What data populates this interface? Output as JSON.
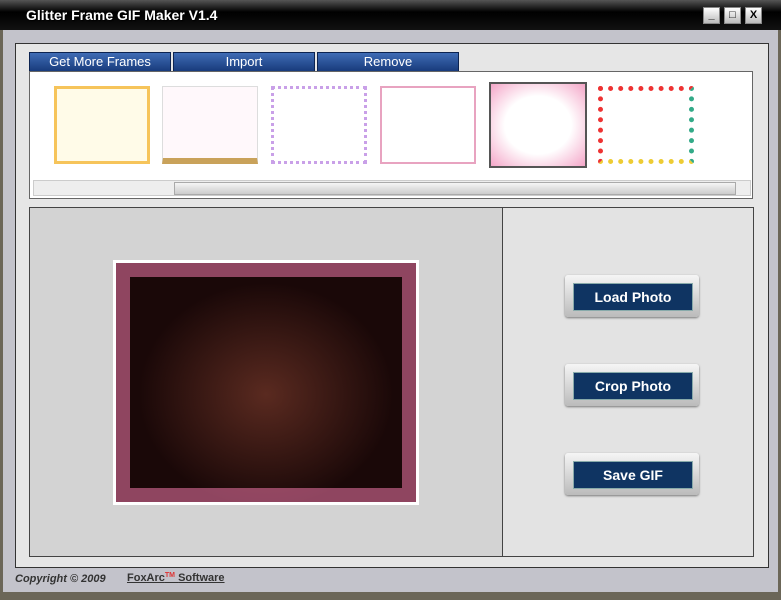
{
  "window": {
    "title": "Glitter Frame GIF Maker V1.4",
    "minimize": "_",
    "maximize": "□",
    "close": "X"
  },
  "tabs": [
    {
      "label": "Get More Frames"
    },
    {
      "label": "Import"
    },
    {
      "label": "Remove"
    }
  ],
  "buttons": {
    "load": "Load Photo",
    "crop": "Crop Photo",
    "save": "Save GIF"
  },
  "footer": {
    "copyright": "Copyright © 2009",
    "brand": "FoxArc",
    "tm": "TM",
    "software": "Software"
  },
  "colors": {
    "button_blue": "#0f3462",
    "tab_blue": "#2a5298"
  }
}
